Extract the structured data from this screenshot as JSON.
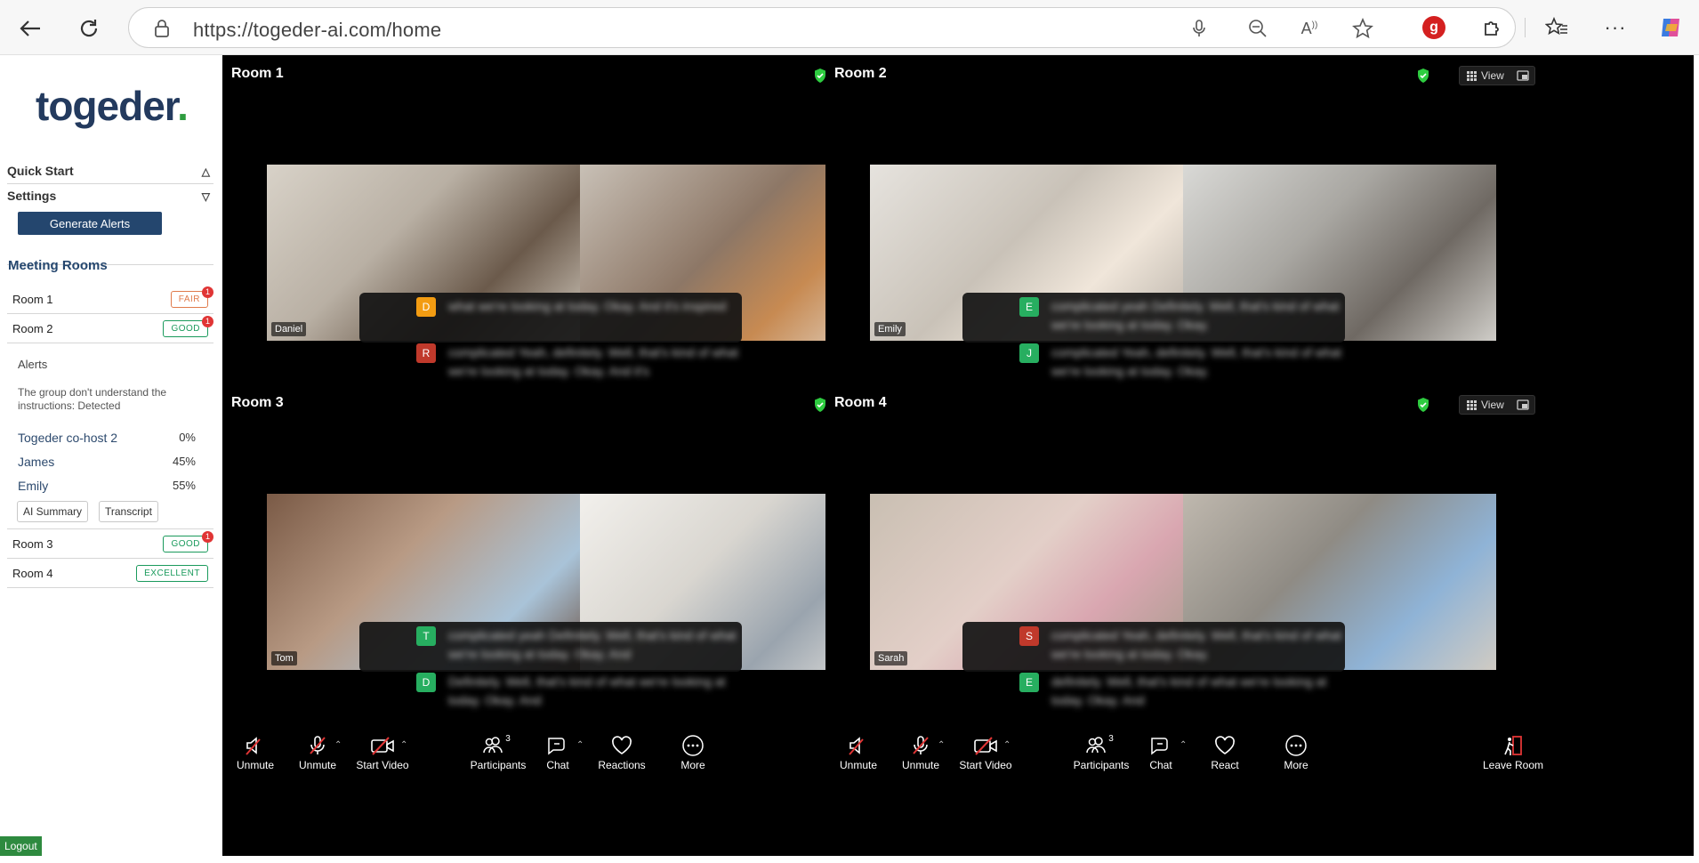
{
  "browser": {
    "url": "https://togeder-ai.com/home"
  },
  "sidebar": {
    "logo": {
      "text": "togeder",
      "dot": "."
    },
    "quick_start": "Quick Start",
    "settings": "Settings",
    "generate_alerts": "Generate Alerts",
    "meeting_rooms_title": "Meeting Rooms",
    "rooms": [
      {
        "label": "Room 1",
        "status": "FAIR",
        "alerts": "1"
      },
      {
        "label": "Room 2",
        "status": "GOOD",
        "alerts": "1"
      },
      {
        "label": "Room 3",
        "status": "GOOD",
        "alerts": "1"
      },
      {
        "label": "Room 4",
        "status": "EXCELLENT",
        "alerts": ""
      }
    ],
    "expanded": {
      "alerts_heading": "Alerts",
      "alert_text": "The group don't understand the instructions: Detected",
      "participants": [
        {
          "name": "Togeder co-host 2",
          "pct": "0%"
        },
        {
          "name": "James",
          "pct": "45%"
        },
        {
          "name": "Emily",
          "pct": "55%"
        }
      ],
      "ai_summary": "AI Summary",
      "transcript": "Transcript"
    },
    "logout": "Logout"
  },
  "controls": {
    "unmute_speaker": "Unmute",
    "unmute_mic": "Unmute",
    "start_video": "Start Video",
    "participants": "Participants",
    "participants_count": "3",
    "chat": "Chat",
    "reactions": "Reactions",
    "react": "React",
    "more": "More",
    "leave": "Leave Room",
    "view": "View"
  },
  "rooms": [
    {
      "title": "Room 1",
      "left_name": "Daniel",
      "captions": [
        {
          "letter": "D",
          "color": "#f39c12",
          "text": "what we're looking at today. Okay. And it's inspired"
        },
        {
          "letter": "R",
          "color": "#c0392b",
          "text": "complicated Yeah, definitely. Well, that's kind of what we're looking at today. Okay. And it's"
        }
      ]
    },
    {
      "title": "Room 2",
      "left_name": "Emily",
      "captions": [
        {
          "letter": "E",
          "color": "#27ae60",
          "text": "complicated yeah Definitely. Well, that's kind of what we're looking at today. Okay."
        },
        {
          "letter": "J",
          "color": "#27ae60",
          "text": "complicated Yeah, definitely. Well, that's kind of what we're looking at today. Okay."
        }
      ]
    },
    {
      "title": "Room 3",
      "left_name": "Tom",
      "captions": [
        {
          "letter": "T",
          "color": "#27ae60",
          "text": "complicated yeah Definitely. Well, that's kind of what we're looking at today. Okay. And"
        },
        {
          "letter": "D",
          "color": "#27ae60",
          "text": "Definitely. Well, that's kind of what we're looking at today. Okay. And"
        }
      ]
    },
    {
      "title": "Room 4",
      "left_name": "Sarah",
      "captions": [
        {
          "letter": "S",
          "color": "#c0392b",
          "text": "complicated Yeah, definitely. Well, that's kind of what we're looking at today. Okay."
        },
        {
          "letter": "E",
          "color": "#27ae60",
          "text": "definitely. Well, that's kind of what we're looking at today. Okay. And"
        }
      ]
    }
  ]
}
